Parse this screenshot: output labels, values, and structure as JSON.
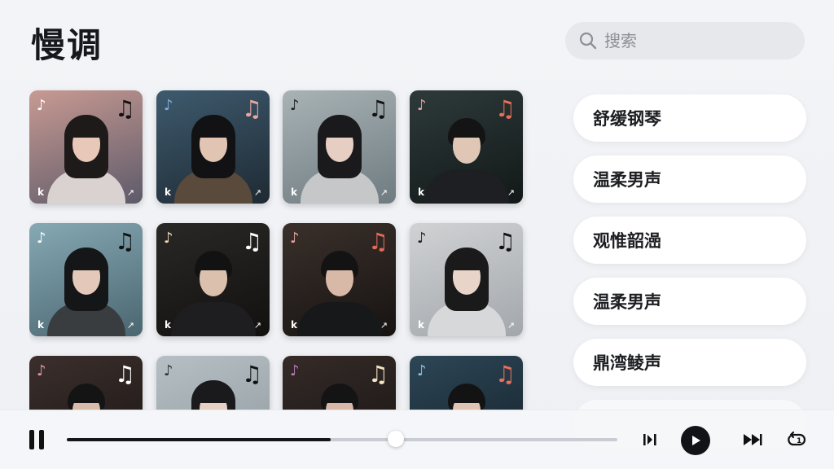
{
  "page": {
    "title": "慢调"
  },
  "search": {
    "placeholder": "搜索"
  },
  "grid": {
    "cards": [
      {
        "row": 0,
        "col": 0,
        "bg1": "#c89a92",
        "bg2": "#5d5a6a",
        "note_small": "#ffffff",
        "note_big": "#111111",
        "hair": "#1f1a1a",
        "body": "#d9d2d0",
        "skin": "#e8c8b8",
        "gender": "f"
      },
      {
        "row": 0,
        "col": 1,
        "bg1": "#3e5a6e",
        "bg2": "#1e2a33",
        "note_small": "#7fb0d8",
        "note_big": "#e9a7a2",
        "hair": "#121214",
        "body": "#5a4a3c",
        "skin": "#e2c4b2",
        "gender": "f"
      },
      {
        "row": 0,
        "col": 2,
        "bg1": "#a9b3b6",
        "bg2": "#6e7b80",
        "note_small": "#222222",
        "note_big": "#111111",
        "hair": "#1a1a1c",
        "body": "#c6c7c8",
        "skin": "#e6cfc2",
        "gender": "f"
      },
      {
        "row": 0,
        "col": 3,
        "bg1": "#2e3a3a",
        "bg2": "#121818",
        "note_small": "#e9a0a6",
        "note_big": "#e8705a",
        "hair": "#141414",
        "body": "#1d1f22",
        "skin": "#e0c6b4",
        "gender": "m"
      },
      {
        "row": 1,
        "col": 0,
        "bg1": "#86a9b4",
        "bg2": "#4a6670",
        "note_small": "#ffffff",
        "note_big": "#111111",
        "hair": "#151617",
        "body": "#3a3d40",
        "skin": "#e4c9ba",
        "gender": "f"
      },
      {
        "row": 1,
        "col": 1,
        "bg1": "#2a2826",
        "bg2": "#121110",
        "note_small": "#f0ddb6",
        "note_big": "#ffffff",
        "hair": "#121212",
        "body": "#1e1e20",
        "skin": "#dcc0ae",
        "gender": "m"
      },
      {
        "row": 1,
        "col": 2,
        "bg1": "#3a302b",
        "bg2": "#171312",
        "note_small": "#e3a2a0",
        "note_big": "#e06b5a",
        "hair": "#141313",
        "body": "#17181a",
        "skin": "#d8b8a6",
        "gender": "m"
      },
      {
        "row": 1,
        "col": 3,
        "bg1": "#d0d2d4",
        "bg2": "#a3a7ab",
        "note_small": "#222222",
        "note_big": "#111111",
        "hair": "#1a1a1b",
        "body": "#d7d8da",
        "skin": "#e8d4c9",
        "gender": "f"
      },
      {
        "row": 2,
        "col": 0,
        "bg1": "#3b2f2c",
        "bg2": "#1a1514",
        "note_small": "#e39aa2",
        "note_big": "#ffffff",
        "hair": "#151414",
        "body": "#222222",
        "skin": "#d9bba9",
        "gender": "m"
      },
      {
        "row": 2,
        "col": 1,
        "bg1": "#b6bfc4",
        "bg2": "#8e999f",
        "note_small": "#333333",
        "note_big": "#111111",
        "hair": "#1a1a1c",
        "body": "#bfc2c5",
        "skin": "#e6d0c4",
        "gender": "f"
      },
      {
        "row": 2,
        "col": 2,
        "bg1": "#352b28",
        "bg2": "#171312",
        "note_small": "#b77cb8",
        "note_big": "#f3e4c2",
        "hair": "#151414",
        "body": "#1f1f20",
        "skin": "#d8b9a7",
        "gender": "m"
      },
      {
        "row": 2,
        "col": 3,
        "bg1": "#2d4656",
        "bg2": "#132029",
        "note_small": "#8fc1df",
        "note_big": "#e8705a",
        "hair": "#131314",
        "body": "#1e2226",
        "skin": "#dfc4b3",
        "gender": "m"
      }
    ]
  },
  "tags": [
    {
      "label": "舒缓钢琴"
    },
    {
      "label": "温柔男声"
    },
    {
      "label": "观惟韶澏"
    },
    {
      "label": "温柔男声"
    },
    {
      "label": "鼎湾鲮声"
    },
    {
      "label": ""
    }
  ],
  "player": {
    "progress": 0.48,
    "pause_icon": "pause-icon",
    "play_icon": "play-icon"
  },
  "colors": {
    "accent": "#121316",
    "tag_bg": "#ffffff",
    "search_bg": "#e6e8ec"
  }
}
